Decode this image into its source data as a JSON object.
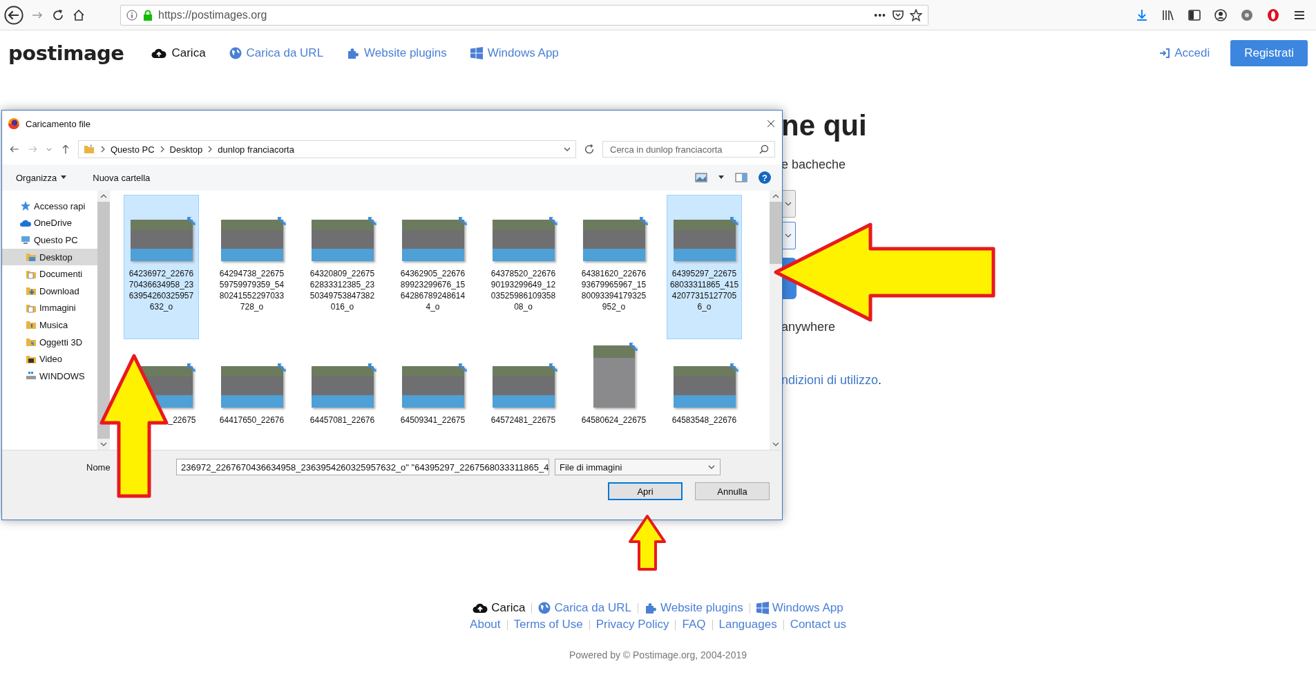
{
  "browser": {
    "url": "https://postimages.org",
    "more": "•••"
  },
  "site_header": {
    "logo": "postimage",
    "nav": [
      {
        "label": "Carica",
        "kind": "upload"
      },
      {
        "label": "Carica da URL",
        "kind": "globe"
      },
      {
        "label": "Website plugins",
        "kind": "puzzle"
      },
      {
        "label": "Windows App",
        "kind": "windows"
      }
    ],
    "login": "Accedi",
    "register": "Registrati"
  },
  "page": {
    "heading": "ne qui",
    "subtitle": "e bacheche",
    "note": "anywhere",
    "terms_link": "ndizioni di utilizzo",
    "terms_end": "."
  },
  "dialog": {
    "title": "Caricamento file",
    "path": [
      "Questo PC",
      "Desktop",
      "dunlop franciacorta"
    ],
    "search_placeholder": "Cerca in dunlop franciacorta",
    "organize": "Organizza",
    "new_folder": "Nuova cartella",
    "help": "?",
    "nav": [
      {
        "label": "Accesso rapi",
        "kind": "star",
        "selected": false
      },
      {
        "label": "OneDrive",
        "kind": "cloud",
        "selected": false
      },
      {
        "label": "Questo PC",
        "kind": "pc",
        "selected": false,
        "children": [
          {
            "label": "Desktop",
            "kind": "desktop",
            "selected": true
          },
          {
            "label": "Documenti",
            "kind": "doc",
            "selected": false
          },
          {
            "label": "Download",
            "kind": "download",
            "selected": false
          },
          {
            "label": "Immagini",
            "kind": "doc",
            "selected": false
          },
          {
            "label": "Musica",
            "kind": "folder",
            "selected": false
          },
          {
            "label": "Oggetti 3D",
            "kind": "folder3d",
            "selected": false
          },
          {
            "label": "Video",
            "kind": "video",
            "selected": false
          },
          {
            "label": "WINDOWS",
            "kind": "drive",
            "selected": false
          }
        ]
      }
    ],
    "files": [
      {
        "name": "64236972_2267670436634958_2363954260325957632_o",
        "selected": true,
        "partial": false,
        "kind": "landscape"
      },
      {
        "name": "64294738_2267559759979359_5480241552297033728_o",
        "selected": false,
        "partial": false,
        "kind": "landscape"
      },
      {
        "name": "64320809_2267562833312385_2350349753847382016_o",
        "selected": false,
        "partial": false,
        "kind": "landscape"
      },
      {
        "name": "64362905_2267689923299676_15642867892486144_o",
        "selected": false,
        "partial": false,
        "kind": "landscape"
      },
      {
        "name": "64378520_2267690193299649_120352598610935808_o",
        "selected": false,
        "partial": false,
        "kind": "landscape"
      },
      {
        "name": "64381620_2267693679965967_1580093394179325952_o",
        "selected": false,
        "partial": false,
        "kind": "landscape"
      },
      {
        "name": "64395297_2267568033311865_415420773151277056_o",
        "selected": true,
        "partial": false,
        "kind": "landscape"
      },
      {
        "name": "_22675",
        "selected": false,
        "partial": true,
        "kind": "landscape"
      },
      {
        "name": "64417650_22676",
        "selected": false,
        "partial": false,
        "kind": "landscape"
      },
      {
        "name": "64457081_22676",
        "selected": false,
        "partial": false,
        "kind": "landscape"
      },
      {
        "name": "64509341_22675",
        "selected": false,
        "partial": false,
        "kind": "landscape"
      },
      {
        "name": "64572481_22675",
        "selected": false,
        "partial": false,
        "kind": "landscape"
      },
      {
        "name": "64580624_22675",
        "selected": false,
        "partial": false,
        "kind": "portrait"
      },
      {
        "name": "64583548_22676",
        "selected": false,
        "partial": false,
        "kind": "landscape"
      }
    ],
    "filename_label": "Nome",
    "filename_value": "236972_2267670436634958_2363954260325957632_o\" \"64395297_2267568033311865_4",
    "filter": "File di immagini",
    "open": "Apri",
    "cancel": "Annulla"
  },
  "footer": {
    "nav": [
      {
        "label": "Carica",
        "kind": "upload"
      },
      {
        "label": "Carica da URL",
        "kind": "globe"
      },
      {
        "label": "Website plugins",
        "kind": "puzzle"
      },
      {
        "label": "Windows App",
        "kind": "windows"
      }
    ],
    "links": [
      "About",
      "Terms of Use",
      "Privacy Policy",
      "FAQ",
      "Languages",
      "Contact us"
    ],
    "powered": "Powered by © Postimage.org, 2004-2019"
  }
}
